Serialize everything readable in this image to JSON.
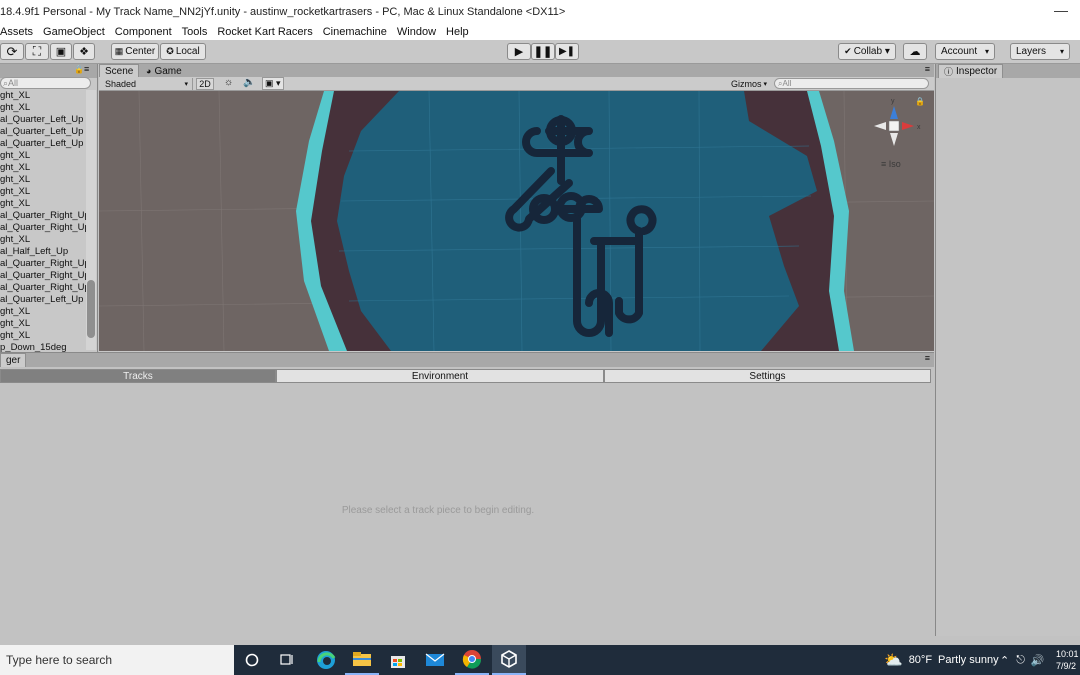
{
  "window": {
    "title": "18.4.9f1 Personal - My Track Name_NN2jYf.unity - austinw_rocketkartrasers - PC, Mac & Linux Standalone <DX11>"
  },
  "menu": [
    "Assets",
    "GameObject",
    "Component",
    "Tools",
    "Rocket Kart Racers",
    "Cinemachine",
    "Window",
    "Help"
  ],
  "toolbar": {
    "center_label": "Center",
    "local_label": "Local",
    "collab_label": "Collab ▾",
    "account_label": "Account",
    "layers_label": "Layers"
  },
  "hierarchy": {
    "search_placeholder": "⌕All",
    "items": [
      "ght_XL",
      "ght_XL",
      "al_Quarter_Left_Up",
      "al_Quarter_Left_Up",
      "al_Quarter_Left_Up",
      "ght_XL",
      "ght_XL",
      "ght_XL",
      "ght_XL",
      "ght_XL",
      "al_Quarter_Right_Up",
      "al_Quarter_Right_Up",
      "ght_XL",
      "al_Half_Left_Up",
      "al_Quarter_Right_Up",
      "al_Quarter_Right_Up",
      "al_Quarter_Right_Up",
      "al_Quarter_Left_Up",
      "ght_XL",
      "ght_XL",
      "ght_XL",
      "p_Down_15deg"
    ]
  },
  "scene": {
    "tab_scene": "Scene",
    "tab_game": "Game",
    "shading_mode": "Shaded",
    "mode_2d": "2D",
    "gizmos_label": "Gizmos",
    "search_placeholder": "⌕All",
    "projection_label": "≡ Iso",
    "gizmo_axes": [
      "y",
      "x"
    ]
  },
  "inspector": {
    "tab_label": "Inspector"
  },
  "track_editor": {
    "tab_label": "ger",
    "tabs": [
      "Tracks",
      "Environment",
      "Settings"
    ],
    "active_tab": "Tracks",
    "message": "Please select a track piece to begin editing."
  },
  "taskbar": {
    "search_placeholder": "Type here to search",
    "weather_temp": "80°F",
    "weather_desc": "Partly sunny",
    "time": "10:01",
    "date": "7/9/2"
  },
  "colors": {
    "viewport_water": "#1f5f7a",
    "viewport_rim": "#5fd0d4",
    "viewport_ground": "#4b3337",
    "track": "#1a2a3a",
    "taskbar": "#1f2c3b"
  }
}
